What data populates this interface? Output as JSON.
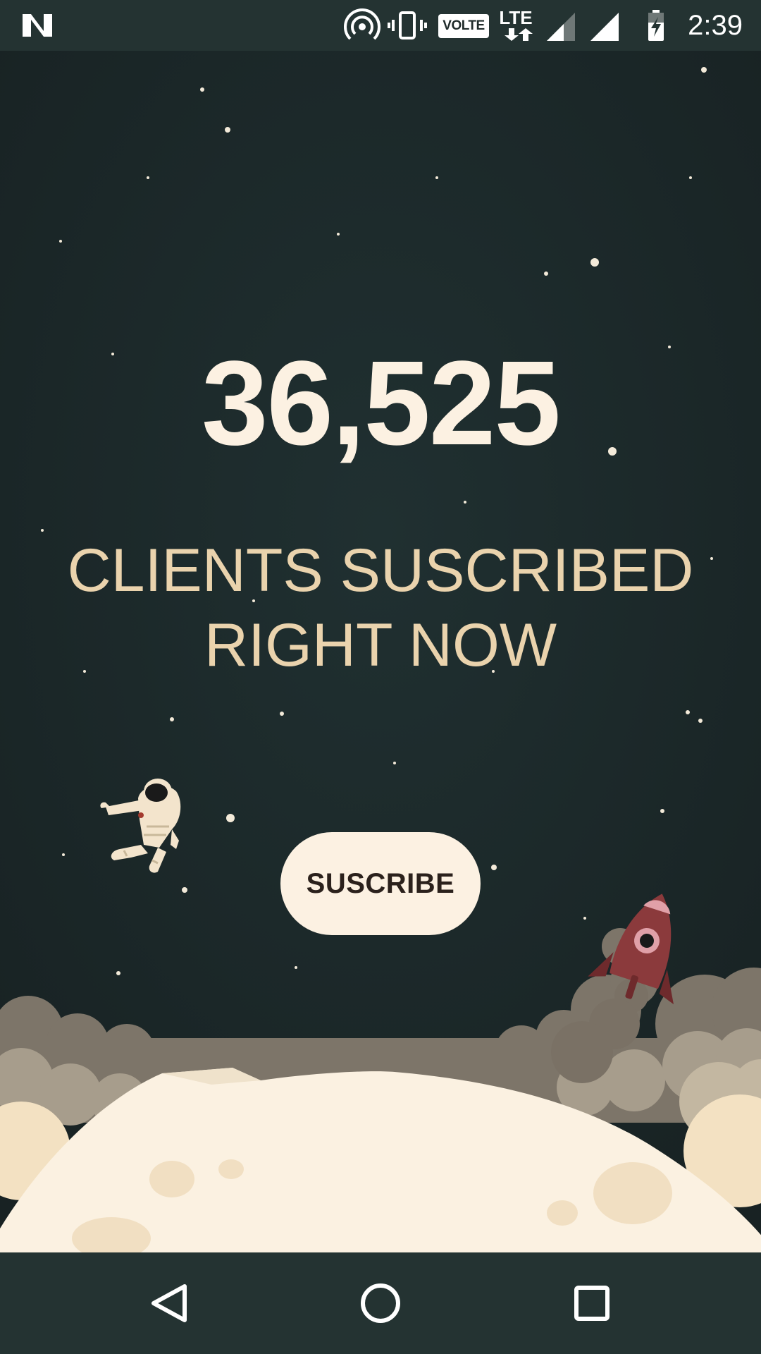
{
  "status_bar": {
    "time": "2:39",
    "network_badge": "VOLTE",
    "network_type": "LTE",
    "icons": [
      "n-logo-icon",
      "hotspot-icon",
      "vibrate-icon",
      "volte-icon",
      "lte-data-icon",
      "signal-icon",
      "signal-full-icon",
      "battery-charging-icon"
    ]
  },
  "main": {
    "subscriber_count": "36,525",
    "caption_line1": "CLIENTS SUSCRIBED",
    "caption_line2": "RIGHT NOW",
    "subscribe_label": "SUSCRIBE"
  },
  "illustration": {
    "items": [
      "astronaut",
      "rocket",
      "smoke-clouds",
      "moon-surface",
      "stars"
    ]
  },
  "nav_bar": {
    "icons": [
      "back-icon",
      "home-icon",
      "recents-icon"
    ]
  },
  "colors": {
    "background": "#1b2627",
    "system_bars": "#243332",
    "counter_text": "#fcf1e2",
    "caption_text": "#ead3ad",
    "button_bg": "#fcf1e2",
    "button_text": "#2b211c",
    "moon": "#fbf1e1",
    "rocket": "#8b3a3c"
  }
}
